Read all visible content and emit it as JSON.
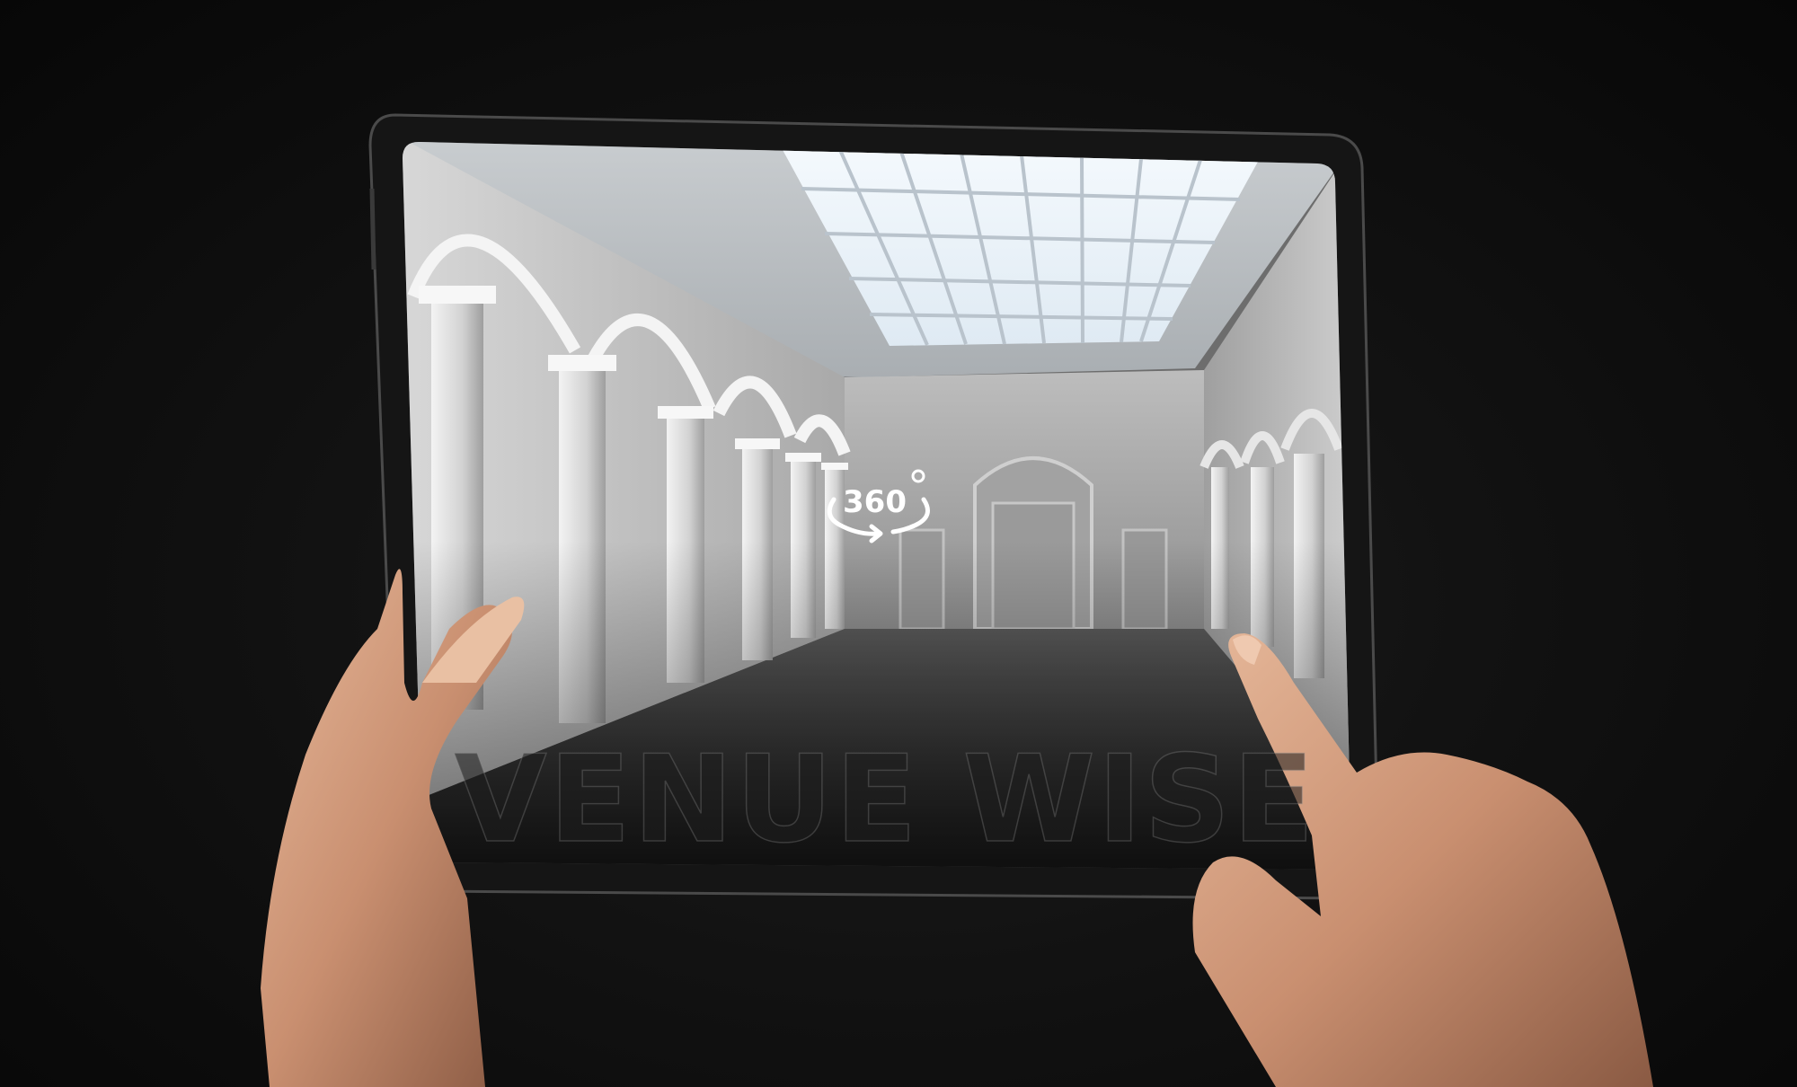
{
  "viewer": {
    "badge_label": "360",
    "badge_icon": "rotate-360-icon",
    "brand_name": "VENUE WISE"
  },
  "colors": {
    "background": "#0b0b0b",
    "device_frame": "#1a1a1a",
    "ceiling": "#d9dde0",
    "skylight": "#e8f2fa",
    "floor": "#4a4a4a",
    "icon": "#ffffff"
  }
}
